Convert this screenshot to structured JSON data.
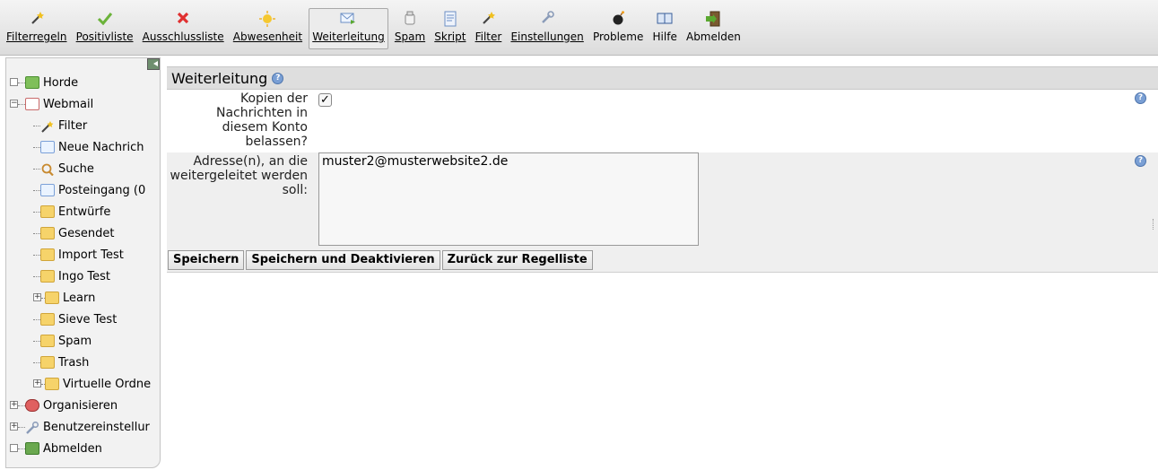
{
  "toolbar": {
    "items": [
      {
        "label": "Filterregeln",
        "icon": "wand-icon"
      },
      {
        "label": "Positivliste",
        "icon": "checkmark-icon"
      },
      {
        "label": "Ausschlussliste",
        "icon": "x-mark-icon"
      },
      {
        "label": "Abwesenheit",
        "icon": "sun-icon"
      },
      {
        "label": "Weiterleitung",
        "icon": "forward-mail-icon"
      },
      {
        "label": "Spam",
        "icon": "spam-icon"
      },
      {
        "label": "Skript",
        "icon": "script-icon"
      },
      {
        "label": "Filter",
        "icon": "wand-icon"
      },
      {
        "label": "Einstellungen",
        "icon": "wrench-icon"
      },
      {
        "label": "Probleme",
        "icon": "bomb-icon"
      },
      {
        "label": "Hilfe",
        "icon": "book-icon"
      },
      {
        "label": "Abmelden",
        "icon": "logout-icon"
      }
    ]
  },
  "sidebar": {
    "items": [
      {
        "label": "Horde"
      },
      {
        "label": "Webmail"
      },
      {
        "label": "Filter"
      },
      {
        "label": "Neue Nachrich"
      },
      {
        "label": "Suche"
      },
      {
        "label": "Posteingang (0"
      },
      {
        "label": "Entwürfe"
      },
      {
        "label": "Gesendet"
      },
      {
        "label": "Import Test"
      },
      {
        "label": "Ingo Test"
      },
      {
        "label": "Learn"
      },
      {
        "label": "Sieve Test"
      },
      {
        "label": "Spam"
      },
      {
        "label": "Trash"
      },
      {
        "label": "Virtuelle Ordne"
      },
      {
        "label": "Organisieren"
      },
      {
        "label": "Benutzereinstellur"
      },
      {
        "label": "Abmelden"
      }
    ]
  },
  "main": {
    "title": "Weiterleitung",
    "keep_copy_label": "Kopien der Nachrichten in diesem Konto belassen?",
    "keep_copy_checked": true,
    "address_label": "Adresse(n), an die weitergeleitet werden soll:",
    "address_value": "muster2@musterwebsite2.de",
    "buttons": {
      "save": "Speichern",
      "save_deactivate": "Speichern und Deaktivieren",
      "back": "Zurück zur Regelliste"
    }
  },
  "colors": {
    "toolbar_bg": "#e4e4e4",
    "sidebar_bg": "#f2f2f2",
    "header_bg": "#dedede",
    "help_icon": "#7a9fd4"
  }
}
